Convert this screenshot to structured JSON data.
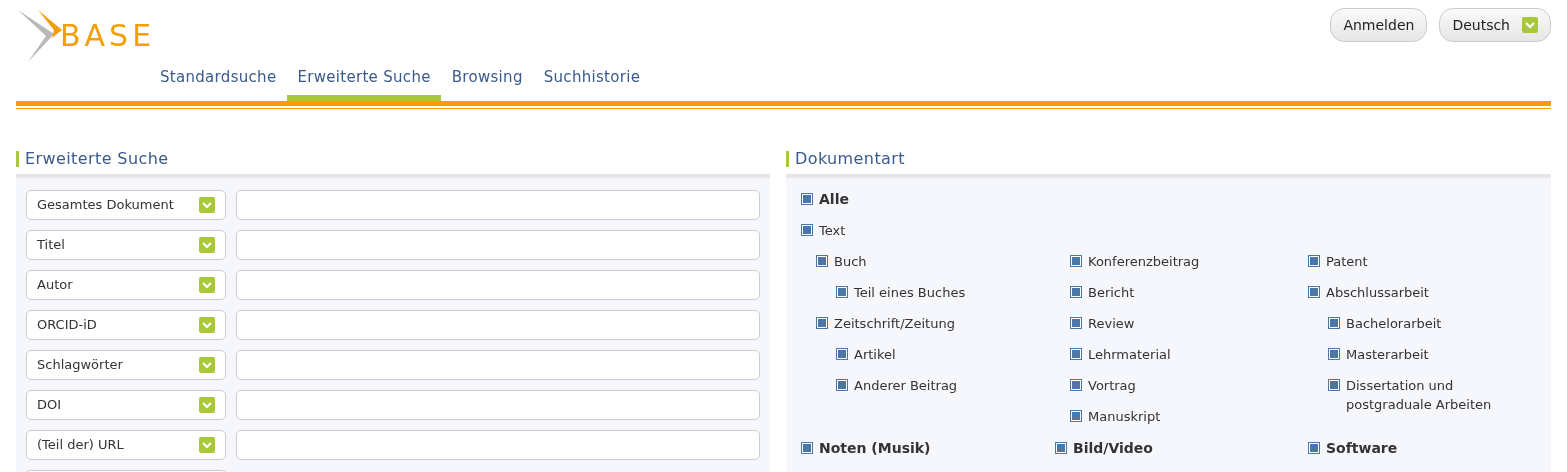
{
  "logo": {
    "text": "BASE"
  },
  "header_buttons": [
    {
      "label": "Anmelden",
      "kind": "plain"
    },
    {
      "label": "Deutsch",
      "kind": "dropdown"
    }
  ],
  "tabs": [
    {
      "label": "Standardsuche",
      "selected": false
    },
    {
      "label": "Erweiterte Suche",
      "selected": true
    },
    {
      "label": "Browsing",
      "selected": false
    },
    {
      "label": "Suchhistorie",
      "selected": false
    }
  ],
  "search_panel": {
    "title": "Erweiterte Suche",
    "rows": [
      {
        "field": "Gesamtes Dokument"
      },
      {
        "field": "Titel"
      },
      {
        "field": "Autor"
      },
      {
        "field": "ORCID-iD"
      },
      {
        "field": "Schlagwörter"
      },
      {
        "field": "DOI"
      },
      {
        "field": "(Teil der) URL"
      }
    ]
  },
  "doctype_panel": {
    "title": "Dokumentart",
    "all": {
      "label": "Alle",
      "checked": true
    },
    "text": {
      "label": "Text",
      "checked": true
    },
    "columns": [
      [
        {
          "label": "Buch",
          "checked": true,
          "children": [
            {
              "label": "Teil eines Buches",
              "checked": true
            }
          ]
        },
        {
          "label": "Zeitschrift/Zeitung",
          "checked": true,
          "children": [
            {
              "label": "Artikel",
              "checked": true
            },
            {
              "label": "Anderer Beitrag",
              "checked": true
            }
          ]
        }
      ],
      [
        {
          "label": "Konferenzbeitrag",
          "checked": true
        },
        {
          "label": "Bericht",
          "checked": true
        },
        {
          "label": "Review",
          "checked": true
        },
        {
          "label": "Lehrmaterial",
          "checked": true
        },
        {
          "label": "Vortrag",
          "checked": true
        },
        {
          "label": "Manuskript",
          "checked": true
        }
      ],
      [
        {
          "label": "Patent",
          "checked": true
        },
        {
          "label": "Abschlussarbeit",
          "checked": true,
          "children": [
            {
              "label": "Bachelorarbeit",
              "checked": true
            },
            {
              "label": "Masterarbeit",
              "checked": true
            },
            {
              "label": "Dissertation und postgraduale Arbeiten",
              "checked": true
            }
          ]
        }
      ]
    ],
    "bottom": [
      {
        "label": "Noten (Musik)",
        "checked": true
      },
      {
        "label": "Bild/Video",
        "checked": true
      },
      {
        "label": "Software",
        "checked": true
      }
    ]
  }
}
